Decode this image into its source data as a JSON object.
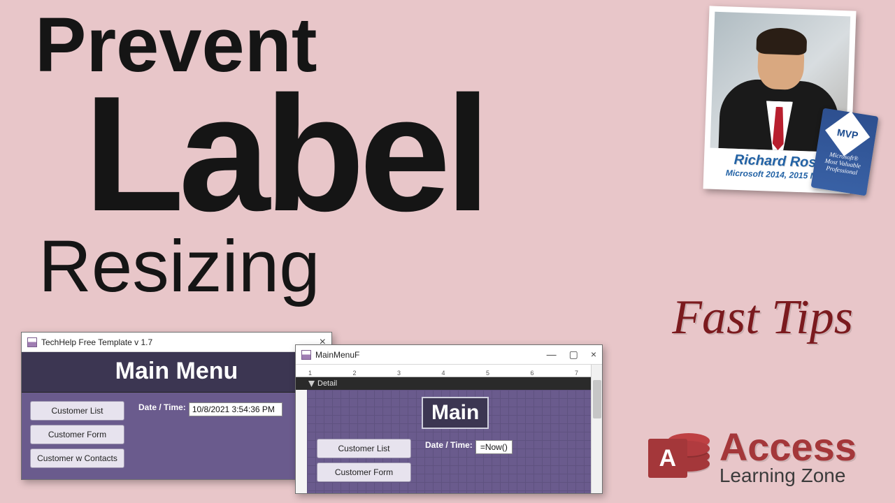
{
  "title": {
    "line1": "Prevent",
    "line2": "Label",
    "line3": "Resizing"
  },
  "photo": {
    "name": "Richard Rost",
    "subtitle": "Microsoft 2014, 2015 MVP"
  },
  "mvp_badge": {
    "diamond": "MVP",
    "line1": "Microsoft®",
    "line2": "Most Valuable",
    "line3": "Professional"
  },
  "fast_tips": "Fast Tips",
  "brand": {
    "letter": "A",
    "main": "Access",
    "sub": "Learning Zone"
  },
  "win1": {
    "title": "TechHelp Free Template v 1.7",
    "close": "×",
    "header": "Main Menu",
    "buttons": [
      "Customer List",
      "Customer Form",
      "Customer w Contacts"
    ],
    "dt_label": "Date / Time:",
    "dt_value": "10/8/2021 3:54:36 PM"
  },
  "win2": {
    "title": "MainMenuF",
    "min": "—",
    "max": "▢",
    "close": "×",
    "ruler": "1 2 3 4 5 6 7",
    "section": "Detail",
    "title_box": "Main",
    "buttons": [
      "Customer List",
      "Customer Form"
    ],
    "dt_label": "Date / Time:",
    "dt_expr": "=Now()"
  }
}
